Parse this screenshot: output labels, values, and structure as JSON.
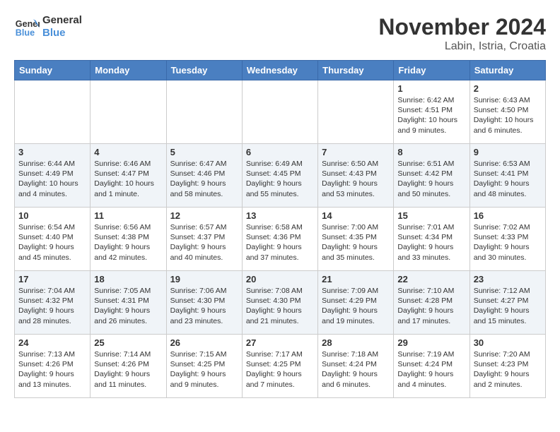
{
  "logo": {
    "line1": "General",
    "line2": "Blue"
  },
  "title": "November 2024",
  "location": "Labin, Istria, Croatia",
  "weekdays": [
    "Sunday",
    "Monday",
    "Tuesday",
    "Wednesday",
    "Thursday",
    "Friday",
    "Saturday"
  ],
  "weeks": [
    [
      {
        "day": "",
        "info": ""
      },
      {
        "day": "",
        "info": ""
      },
      {
        "day": "",
        "info": ""
      },
      {
        "day": "",
        "info": ""
      },
      {
        "day": "",
        "info": ""
      },
      {
        "day": "1",
        "info": "Sunrise: 6:42 AM\nSunset: 4:51 PM\nDaylight: 10 hours and 9 minutes."
      },
      {
        "day": "2",
        "info": "Sunrise: 6:43 AM\nSunset: 4:50 PM\nDaylight: 10 hours and 6 minutes."
      }
    ],
    [
      {
        "day": "3",
        "info": "Sunrise: 6:44 AM\nSunset: 4:49 PM\nDaylight: 10 hours and 4 minutes."
      },
      {
        "day": "4",
        "info": "Sunrise: 6:46 AM\nSunset: 4:47 PM\nDaylight: 10 hours and 1 minute."
      },
      {
        "day": "5",
        "info": "Sunrise: 6:47 AM\nSunset: 4:46 PM\nDaylight: 9 hours and 58 minutes."
      },
      {
        "day": "6",
        "info": "Sunrise: 6:49 AM\nSunset: 4:45 PM\nDaylight: 9 hours and 55 minutes."
      },
      {
        "day": "7",
        "info": "Sunrise: 6:50 AM\nSunset: 4:43 PM\nDaylight: 9 hours and 53 minutes."
      },
      {
        "day": "8",
        "info": "Sunrise: 6:51 AM\nSunset: 4:42 PM\nDaylight: 9 hours and 50 minutes."
      },
      {
        "day": "9",
        "info": "Sunrise: 6:53 AM\nSunset: 4:41 PM\nDaylight: 9 hours and 48 minutes."
      }
    ],
    [
      {
        "day": "10",
        "info": "Sunrise: 6:54 AM\nSunset: 4:40 PM\nDaylight: 9 hours and 45 minutes."
      },
      {
        "day": "11",
        "info": "Sunrise: 6:56 AM\nSunset: 4:38 PM\nDaylight: 9 hours and 42 minutes."
      },
      {
        "day": "12",
        "info": "Sunrise: 6:57 AM\nSunset: 4:37 PM\nDaylight: 9 hours and 40 minutes."
      },
      {
        "day": "13",
        "info": "Sunrise: 6:58 AM\nSunset: 4:36 PM\nDaylight: 9 hours and 37 minutes."
      },
      {
        "day": "14",
        "info": "Sunrise: 7:00 AM\nSunset: 4:35 PM\nDaylight: 9 hours and 35 minutes."
      },
      {
        "day": "15",
        "info": "Sunrise: 7:01 AM\nSunset: 4:34 PM\nDaylight: 9 hours and 33 minutes."
      },
      {
        "day": "16",
        "info": "Sunrise: 7:02 AM\nSunset: 4:33 PM\nDaylight: 9 hours and 30 minutes."
      }
    ],
    [
      {
        "day": "17",
        "info": "Sunrise: 7:04 AM\nSunset: 4:32 PM\nDaylight: 9 hours and 28 minutes."
      },
      {
        "day": "18",
        "info": "Sunrise: 7:05 AM\nSunset: 4:31 PM\nDaylight: 9 hours and 26 minutes."
      },
      {
        "day": "19",
        "info": "Sunrise: 7:06 AM\nSunset: 4:30 PM\nDaylight: 9 hours and 23 minutes."
      },
      {
        "day": "20",
        "info": "Sunrise: 7:08 AM\nSunset: 4:30 PM\nDaylight: 9 hours and 21 minutes."
      },
      {
        "day": "21",
        "info": "Sunrise: 7:09 AM\nSunset: 4:29 PM\nDaylight: 9 hours and 19 minutes."
      },
      {
        "day": "22",
        "info": "Sunrise: 7:10 AM\nSunset: 4:28 PM\nDaylight: 9 hours and 17 minutes."
      },
      {
        "day": "23",
        "info": "Sunrise: 7:12 AM\nSunset: 4:27 PM\nDaylight: 9 hours and 15 minutes."
      }
    ],
    [
      {
        "day": "24",
        "info": "Sunrise: 7:13 AM\nSunset: 4:26 PM\nDaylight: 9 hours and 13 minutes."
      },
      {
        "day": "25",
        "info": "Sunrise: 7:14 AM\nSunset: 4:26 PM\nDaylight: 9 hours and 11 minutes."
      },
      {
        "day": "26",
        "info": "Sunrise: 7:15 AM\nSunset: 4:25 PM\nDaylight: 9 hours and 9 minutes."
      },
      {
        "day": "27",
        "info": "Sunrise: 7:17 AM\nSunset: 4:25 PM\nDaylight: 9 hours and 7 minutes."
      },
      {
        "day": "28",
        "info": "Sunrise: 7:18 AM\nSunset: 4:24 PM\nDaylight: 9 hours and 6 minutes."
      },
      {
        "day": "29",
        "info": "Sunrise: 7:19 AM\nSunset: 4:24 PM\nDaylight: 9 hours and 4 minutes."
      },
      {
        "day": "30",
        "info": "Sunrise: 7:20 AM\nSunset: 4:23 PM\nDaylight: 9 hours and 2 minutes."
      }
    ]
  ]
}
